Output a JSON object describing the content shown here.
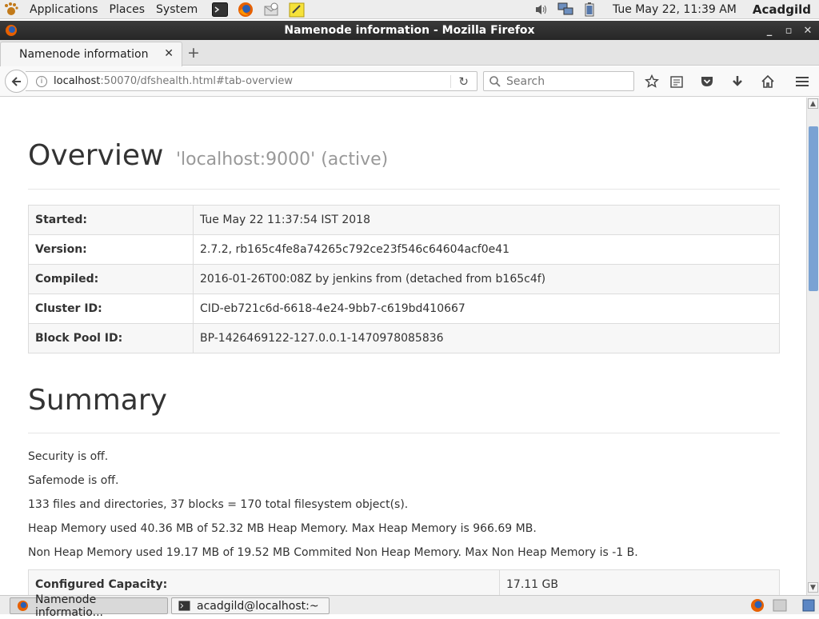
{
  "panel": {
    "menus": [
      "Applications",
      "Places",
      "System"
    ],
    "clock": "Tue May 22, 11:39 AM",
    "user": "Acadgild"
  },
  "window": {
    "title": "Namenode information - Mozilla Firefox"
  },
  "tab": {
    "title": "Namenode information"
  },
  "nav": {
    "url_host": "localhost",
    "url_rest": ":50070/dfshealth.html#tab-overview",
    "search_placeholder": "Search"
  },
  "overview": {
    "heading": "Overview",
    "subheading": "'localhost:9000' (active)",
    "rows": [
      {
        "label": "Started:",
        "value": "Tue May 22 11:37:54 IST 2018"
      },
      {
        "label": "Version:",
        "value": "2.7.2, rb165c4fe8a74265c792ce23f546c64604acf0e41"
      },
      {
        "label": "Compiled:",
        "value": "2016-01-26T00:08Z by jenkins from (detached from b165c4f)"
      },
      {
        "label": "Cluster ID:",
        "value": "CID-eb721c6d-6618-4e24-9bb7-c619bd410667"
      },
      {
        "label": "Block Pool ID:",
        "value": "BP-1426469122-127.0.0.1-1470978085836"
      }
    ]
  },
  "summary": {
    "heading": "Summary",
    "lines": [
      "Security is off.",
      "Safemode is off.",
      "133 files and directories, 37 blocks = 170 total filesystem object(s).",
      "Heap Memory used 40.36 MB of 52.32 MB Heap Memory. Max Heap Memory is 966.69 MB.",
      "Non Heap Memory used 19.17 MB of 19.52 MB Commited Non Heap Memory. Max Non Heap Memory is -1 B."
    ],
    "capacity_label": "Configured Capacity:",
    "capacity_value": "17.11 GB"
  },
  "taskbar": {
    "tasks": [
      "Namenode informatio...",
      "acadgild@localhost:~"
    ]
  },
  "colors": {
    "accent": "#7aa2d3",
    "titlebar": "#2e2e2e"
  }
}
